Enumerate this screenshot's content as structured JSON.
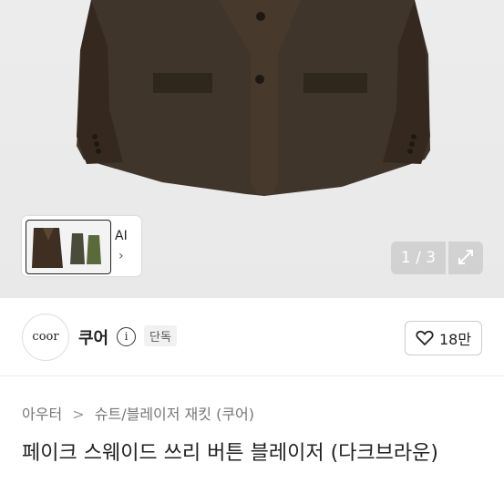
{
  "gallery": {
    "ai_label": "AI",
    "ai_chevron": "›",
    "counter": "1 / 3",
    "expand_icon": "expand-icon"
  },
  "seller": {
    "logo_text": "coor",
    "name": "쿠어",
    "info_icon": "i",
    "badge": "단독"
  },
  "like": {
    "count": "18만",
    "icon": "heart-icon"
  },
  "breadcrumb": {
    "items": [
      "아우터",
      "슈트/블레이저 재킷 (쿠어)"
    ],
    "separator": ">"
  },
  "product": {
    "title": "페이크 스웨이드 쓰리 버튼 블레이저 (다크브라운)"
  },
  "colors": {
    "jacket": "#3d3326",
    "background": "#ebebeb"
  }
}
